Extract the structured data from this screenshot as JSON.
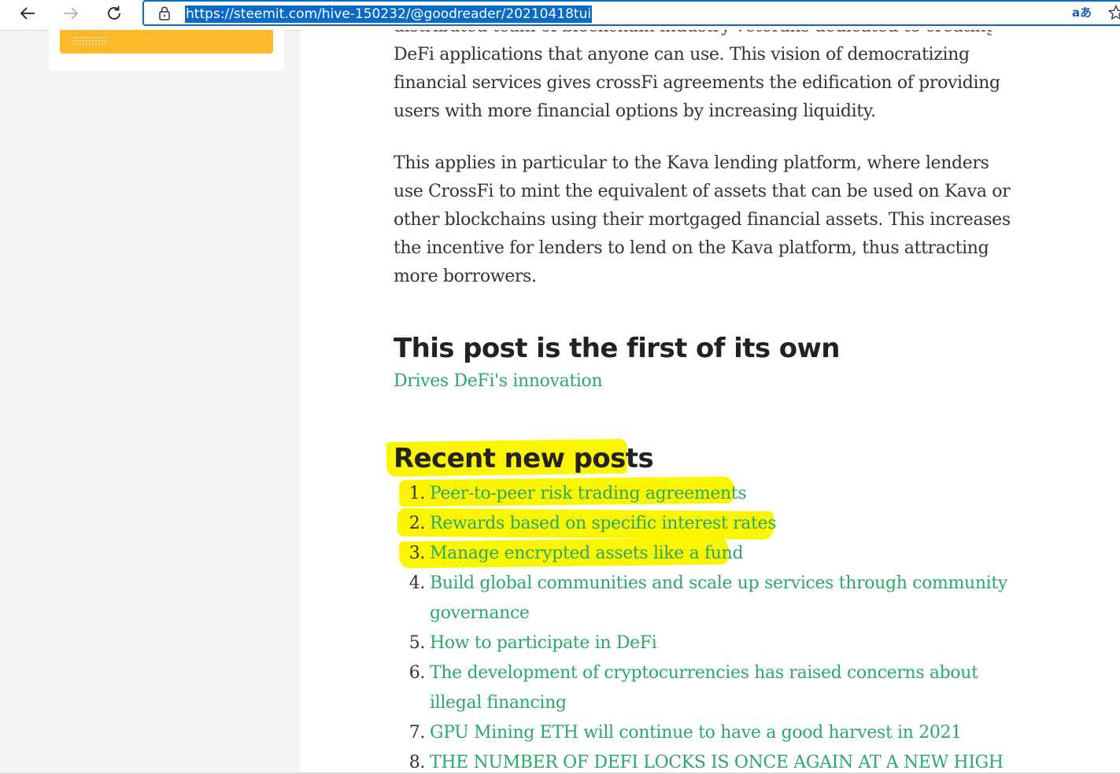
{
  "browser": {
    "url": "https://steemit.com/hive-150232/@goodreader/20210418tui",
    "translate_glyph": "aあ"
  },
  "article": {
    "cut_line": "distributed team of blockchain industry veterans dedicated to creating",
    "para1": "DeFi applications that anyone can use. This vision of democratizing financial services gives crossFi agreements the edification of providing users with more financial options by increasing liquidity.",
    "para2": "This applies in particular to the Kava lending platform, where lenders use CrossFi to mint the equivalent of assets that can be used on Kava or other blockchains using their mortgaged financial assets. This increases the incentive for lenders to lend on the Kava platform, thus attracting more borrowers.",
    "heading_own": "This post is the first of its own",
    "drives_link": "Drives DeFi's innovation",
    "heading_recent": "Recent new posts",
    "posts": [
      {
        "num": "1",
        "title": "Peer-to-peer risk trading agreements"
      },
      {
        "num": "2",
        "title": "Rewards based on specific interest rates"
      },
      {
        "num": "3",
        "title": "Manage encrypted assets like a fund"
      },
      {
        "num": "4",
        "title": "Build global communities and scale up services through community governance"
      },
      {
        "num": "5",
        "title": "How to participate in DeFi"
      },
      {
        "num": "6",
        "title": "The development of cryptocurrencies has raised concerns about illegal financing"
      },
      {
        "num": "7",
        "title": "GPU Mining ETH will continue to have a good harvest in 2021"
      },
      {
        "num": "8",
        "title": "THE NUMBER OF DEFI LOCKS IS ONCE AGAIN AT A NEW HIGH"
      }
    ]
  },
  "colors": {
    "link": "#2aa86a",
    "highlight": "#fbf500",
    "sidebar_button": "#fdb92c",
    "url_selection": "#0a6ac8"
  }
}
